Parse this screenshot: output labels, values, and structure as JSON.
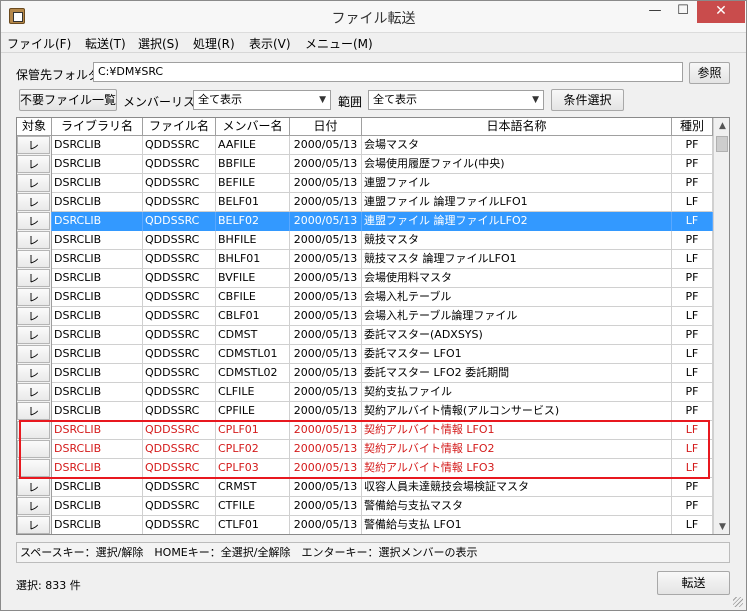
{
  "window": {
    "title": "ファイル転送",
    "minimize": "—",
    "maximize": "☐",
    "close": "✕"
  },
  "menu": [
    "ファイル(F)",
    "転送(T)",
    "選択(S)",
    "処理(R)",
    "表示(V)",
    "メニュー(M)"
  ],
  "folder": {
    "label": "保管先フォルダ",
    "value": "C:¥DM¥SRC",
    "browse_label": "参照"
  },
  "filters": {
    "unneeded_label": "不要ファイル一覧",
    "member_list_label": "メンバーリスト",
    "member_list_value": "全て表示",
    "range_label": "範囲",
    "range_value": "全て表示",
    "condition_label": "条件選択"
  },
  "table": {
    "headers": [
      "対象",
      "ライブラリ名",
      "ファイル名",
      "メンバー名",
      "日付",
      "日本語名称",
      "種別"
    ],
    "rows": [
      {
        "check": "レ",
        "lib": "DSRCLIB",
        "file": "QDDSSRC",
        "member": "AAFILE",
        "date": "2000/05/13",
        "name": "会場マスタ",
        "type": "PF",
        "state": "normal"
      },
      {
        "check": "レ",
        "lib": "DSRCLIB",
        "file": "QDDSSRC",
        "member": "BBFILE",
        "date": "2000/05/13",
        "name": "会場使用履歴ファイル(中央)",
        "type": "PF",
        "state": "normal"
      },
      {
        "check": "レ",
        "lib": "DSRCLIB",
        "file": "QDDSSRC",
        "member": "BEFILE",
        "date": "2000/05/13",
        "name": "連盟ファイル",
        "type": "PF",
        "state": "normal"
      },
      {
        "check": "レ",
        "lib": "DSRCLIB",
        "file": "QDDSSRC",
        "member": "BELF01",
        "date": "2000/05/13",
        "name": "連盟ファイル 論理ファイルLFO1",
        "type": "LF",
        "state": "normal"
      },
      {
        "check": "レ",
        "lib": "DSRCLIB",
        "file": "QDDSSRC",
        "member": "BELF02",
        "date": "2000/05/13",
        "name": "連盟ファイル 論理ファイルLFO2",
        "type": "LF",
        "state": "selected"
      },
      {
        "check": "レ",
        "lib": "DSRCLIB",
        "file": "QDDSSRC",
        "member": "BHFILE",
        "date": "2000/05/13",
        "name": "競技マスタ",
        "type": "PF",
        "state": "normal"
      },
      {
        "check": "レ",
        "lib": "DSRCLIB",
        "file": "QDDSSRC",
        "member": "BHLF01",
        "date": "2000/05/13",
        "name": "競技マスタ 論理ファイルLFO1",
        "type": "LF",
        "state": "normal"
      },
      {
        "check": "レ",
        "lib": "DSRCLIB",
        "file": "QDDSSRC",
        "member": "BVFILE",
        "date": "2000/05/13",
        "name": "会場使用料マスタ",
        "type": "PF",
        "state": "normal"
      },
      {
        "check": "レ",
        "lib": "DSRCLIB",
        "file": "QDDSSRC",
        "member": "CBFILE",
        "date": "2000/05/13",
        "name": "会場入札テーブル",
        "type": "PF",
        "state": "normal"
      },
      {
        "check": "レ",
        "lib": "DSRCLIB",
        "file": "QDDSSRC",
        "member": "CBLF01",
        "date": "2000/05/13",
        "name": "会場入札テーブル論理ファイル",
        "type": "LF",
        "state": "normal"
      },
      {
        "check": "レ",
        "lib": "DSRCLIB",
        "file": "QDDSSRC",
        "member": "CDMST",
        "date": "2000/05/13",
        "name": "委託マスター(ADXSYS)",
        "type": "PF",
        "state": "normal"
      },
      {
        "check": "レ",
        "lib": "DSRCLIB",
        "file": "QDDSSRC",
        "member": "CDMSTL01",
        "date": "2000/05/13",
        "name": "委託マスター LFO1",
        "type": "LF",
        "state": "normal"
      },
      {
        "check": "レ",
        "lib": "DSRCLIB",
        "file": "QDDSSRC",
        "member": "CDMSTL02",
        "date": "2000/05/13",
        "name": "委託マスター LFO2 委託期間",
        "type": "LF",
        "state": "normal"
      },
      {
        "check": "レ",
        "lib": "DSRCLIB",
        "file": "QDDSSRC",
        "member": "CLFILE",
        "date": "2000/05/13",
        "name": "契約支払ファイル",
        "type": "PF",
        "state": "normal"
      },
      {
        "check": "レ",
        "lib": "DSRCLIB",
        "file": "QDDSSRC",
        "member": "CPFILE",
        "date": "2000/05/13",
        "name": "契約アルバイト情報(アルコンサービス)",
        "type": "PF",
        "state": "normal"
      },
      {
        "check": "",
        "lib": "DSRCLIB",
        "file": "QDDSSRC",
        "member": "CPLF01",
        "date": "2000/05/13",
        "name": "契約アルバイト情報 LFO1",
        "type": "LF",
        "state": "unsel"
      },
      {
        "check": "",
        "lib": "DSRCLIB",
        "file": "QDDSSRC",
        "member": "CPLF02",
        "date": "2000/05/13",
        "name": "契約アルバイト情報 LFO2",
        "type": "LF",
        "state": "unsel"
      },
      {
        "check": "",
        "lib": "DSRCLIB",
        "file": "QDDSSRC",
        "member": "CPLF03",
        "date": "2000/05/13",
        "name": "契約アルバイト情報 LFO3",
        "type": "LF",
        "state": "unsel"
      },
      {
        "check": "レ",
        "lib": "DSRCLIB",
        "file": "QDDSSRC",
        "member": "CRMST",
        "date": "2000/05/13",
        "name": "収容人員未達競技会場検証マスタ",
        "type": "PF",
        "state": "normal"
      },
      {
        "check": "レ",
        "lib": "DSRCLIB",
        "file": "QDDSSRC",
        "member": "CTFILE",
        "date": "2000/05/13",
        "name": "警備給与支払マスタ",
        "type": "PF",
        "state": "normal"
      },
      {
        "check": "レ",
        "lib": "DSRCLIB",
        "file": "QDDSSRC",
        "member": "CTLF01",
        "date": "2000/05/13",
        "name": "警備給与支払 LFO1",
        "type": "LF",
        "state": "normal"
      }
    ]
  },
  "hint": "スペースキー：選択/解除　HOMEキー：全選択/全解除　エンターキー：選択メンバーの表示",
  "status": {
    "selected": "選択: 833 件"
  },
  "transfer_label": "転送",
  "colors": {
    "selection": "#3399ff",
    "unselected_text": "#d41b1b",
    "highlight_box": "#e8181f"
  }
}
